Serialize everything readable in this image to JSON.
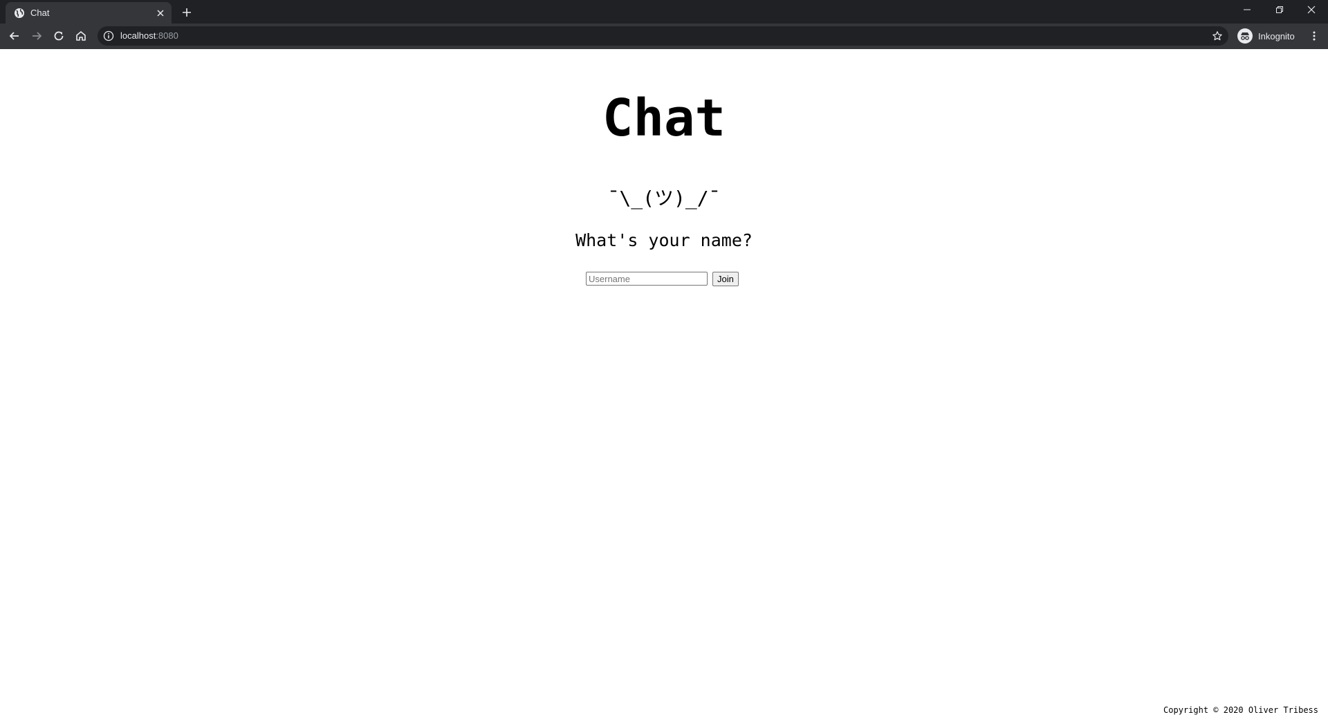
{
  "browser": {
    "tab": {
      "title": "Chat",
      "favicon": "globe-icon"
    },
    "window_controls": [
      "minimize-icon",
      "restore-icon",
      "close-icon"
    ],
    "address_bar": {
      "host": "localhost",
      "port": ":8080"
    },
    "profile": {
      "label": "Inkognito",
      "icon": "incognito-icon"
    },
    "colors": {
      "chrome_dark": "#202124",
      "toolbar": "#35363a",
      "text": "#e8eaed",
      "muted_text": "#9aa0a6"
    }
  },
  "page": {
    "title": "Chat",
    "shrug": "¯\\_(ツ)_/¯",
    "question": "What's your name?",
    "username_placeholder": "Username",
    "username_value": "",
    "join_label": "Join",
    "footer": "Copyright © 2020 Oliver Tribess"
  }
}
